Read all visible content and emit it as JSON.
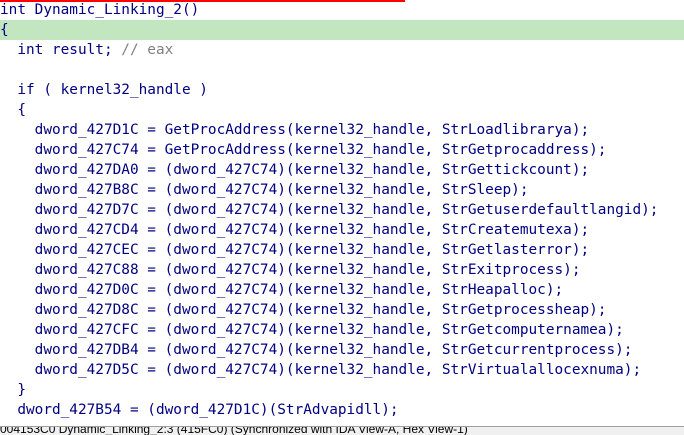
{
  "code_lines": [
    "int Dynamic_Linking_2()",
    "{",
    "  int result; // eax",
    "",
    "  if ( kernel32_handle )",
    "  {",
    "    dword_427D1C = GetProcAddress(kernel32_handle, StrLoadlibrarya);",
    "    dword_427C74 = GetProcAddress(kernel32_handle, StrGetprocaddress);",
    "    dword_427DA0 = (dword_427C74)(kernel32_handle, StrGettickcount);",
    "    dword_427B8C = (dword_427C74)(kernel32_handle, StrSleep);",
    "    dword_427D7C = (dword_427C74)(kernel32_handle, StrGetuserdefaultlangid);",
    "    dword_427CD4 = (dword_427C74)(kernel32_handle, StrCreatemutexa);",
    "    dword_427CEC = (dword_427C74)(kernel32_handle, StrGetlasterror);",
    "    dword_427C88 = (dword_427C74)(kernel32_handle, StrExitprocess);",
    "    dword_427D0C = (dword_427C74)(kernel32_handle, StrHeapalloc);",
    "    dword_427D8C = (dword_427C74)(kernel32_handle, StrGetprocessheap);",
    "    dword_427CFC = (dword_427C74)(kernel32_handle, StrGetcomputernamea);",
    "    dword_427DB4 = (dword_427C74)(kernel32_handle, StrGetcurrentprocess);",
    "    dword_427D5C = (dword_427C74)(kernel32_handle, StrVirtualallocexnuma);",
    "  }",
    "  dword_427B54 = (dword_427D1C)(StrAdvapidll);"
  ],
  "status_bar": {
    "text": "004153C0 Dynamic_Linking_2:3 (415FC0) (Synchronized with IDA View-A, Hex View-1)"
  },
  "colors": {
    "highlight_line": "#c2e6bf",
    "code_text": "#000080",
    "comment_text": "#808080",
    "top_marker": "#ff0000"
  }
}
